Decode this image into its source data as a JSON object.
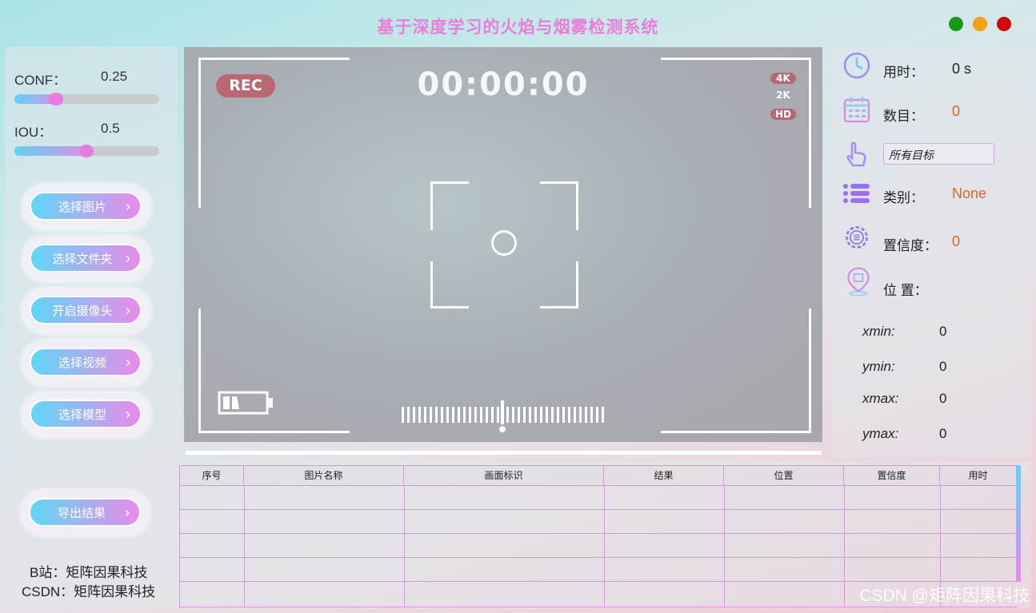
{
  "app": {
    "title": "基于深度学习的火焰与烟雾检测系统"
  },
  "window_buttons": {
    "minimize_color": "#139a17",
    "maximize_color": "#f2a20f",
    "close_color": "#cf0a0a"
  },
  "params": {
    "conf": {
      "label": "CONF：",
      "value": "0.25",
      "fraction": 0.25
    },
    "iou": {
      "label": "IOU：",
      "value": "0.5",
      "fraction": 0.5
    }
  },
  "buttons": {
    "select_image": "选择图片",
    "select_folder": "选择文件夹",
    "open_camera": "开启摄像头",
    "select_video": "选择视频",
    "select_model": "选择模型",
    "export": "导出结果"
  },
  "video": {
    "rec": "REC",
    "clock": "00:00:00",
    "res_4k": "4K",
    "res_2k": "2K",
    "res_hd": "HD"
  },
  "stats": {
    "time_label": "用时：",
    "time_value": "0 s",
    "count_label": "数目：",
    "count_value": "0",
    "target_select": "所有目标",
    "class_label": "类别：",
    "class_value": "None",
    "conf_label": "置信度：",
    "conf_value": "0",
    "pos_label": "位 置：",
    "xmin_label": "xmin:",
    "xmin": "0",
    "ymin_label": "ymin:",
    "ymin": "0",
    "xmax_label": "xmax:",
    "xmax": "0",
    "ymax_label": "ymax:",
    "ymax": "0"
  },
  "table": {
    "headers": [
      "序号",
      "图片名称",
      "画面标识",
      "结果",
      "位置",
      "置信度",
      "用时"
    ],
    "rows": []
  },
  "credits": {
    "bilibili": "B站：矩阵因果科技",
    "csdn": "CSDN：矩阵因果科技"
  },
  "watermark": "CSDN @矩阵因果科技"
}
